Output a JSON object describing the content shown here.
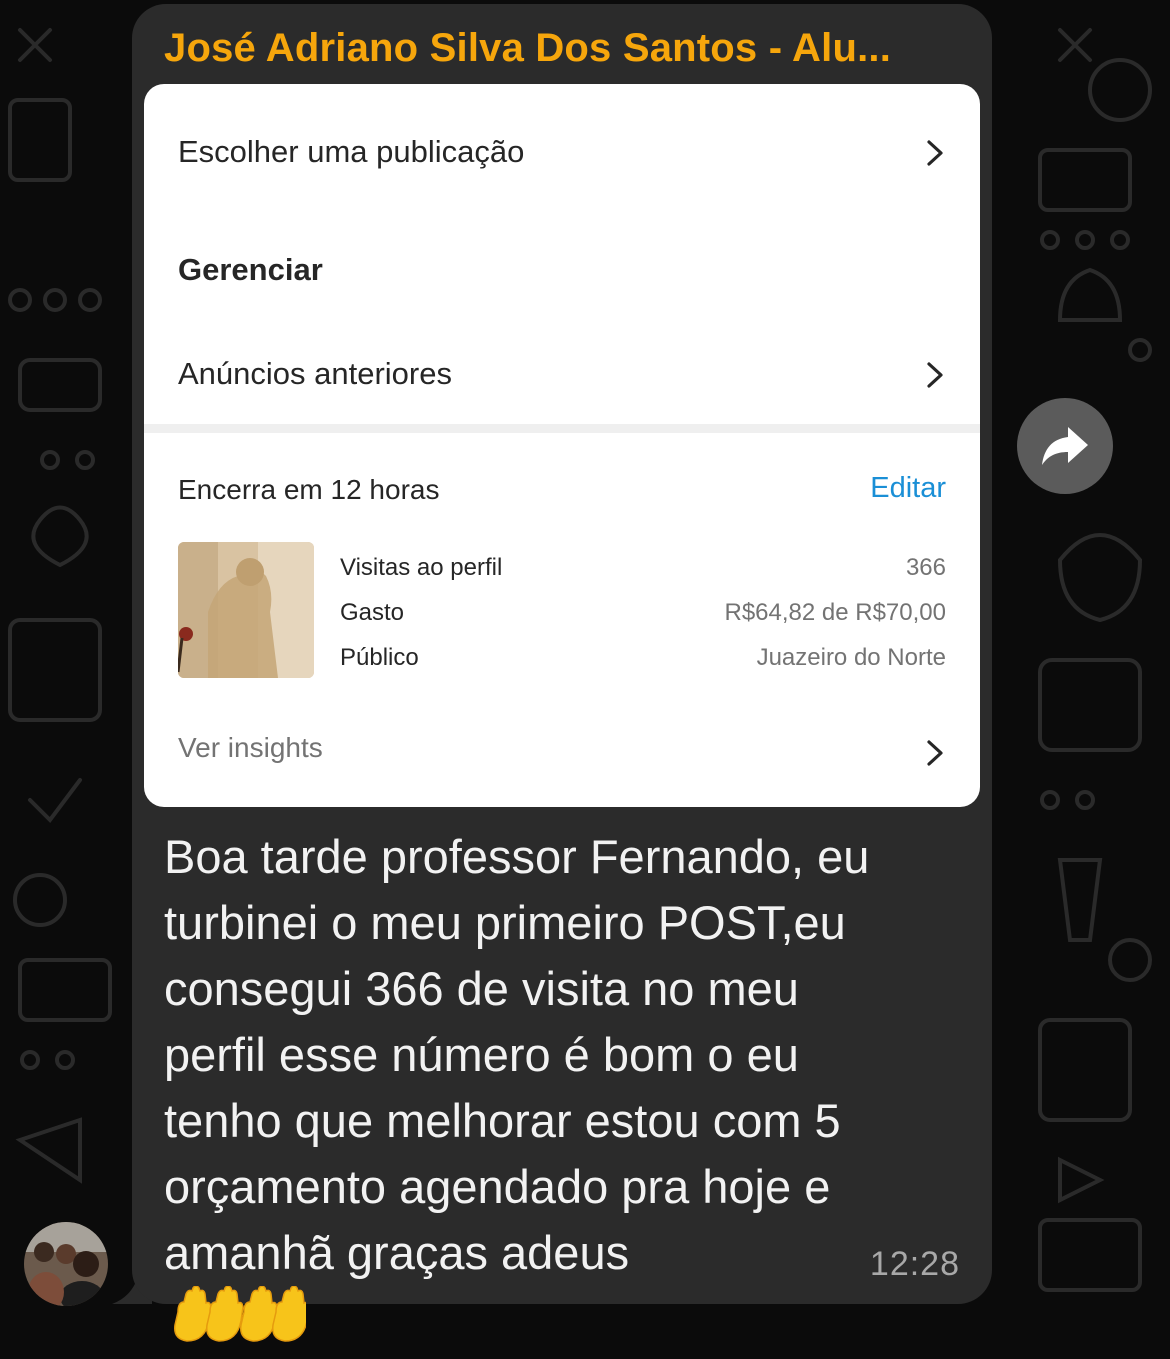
{
  "chat": {
    "sender_name": "José Adriano Silva Dos Santos - Alu...",
    "time": "12:28",
    "message_lines": [
      "Boa tarde professor Fernando, eu",
      "turbinei o meu primeiro POST,eu",
      "consegui 366 de visita no meu",
      "perfil esse número é bom o eu",
      "tenho que melhorar estou com 5",
      "orçamento agendado pra hoje e",
      "amanhã graças adeus"
    ],
    "emoji": "raising-hands x2"
  },
  "card": {
    "choose_post": "Escolher uma publicação",
    "manage_heading": "Gerenciar",
    "past_ads": "Anúncios anteriores",
    "ends_in": "Encerra em 12 horas",
    "edit": "Editar",
    "stats": [
      {
        "label": "Visitas ao perfil",
        "value": "366"
      },
      {
        "label": "Gasto",
        "value": "R$64,82 de R$70,00"
      },
      {
        "label": "Público",
        "value": "Juazeiro do Norte"
      }
    ],
    "see_insights": "Ver insights"
  },
  "colors": {
    "sender": "#f6a60c",
    "link": "#1a8fd6",
    "bubble": "#2b2b2b"
  }
}
